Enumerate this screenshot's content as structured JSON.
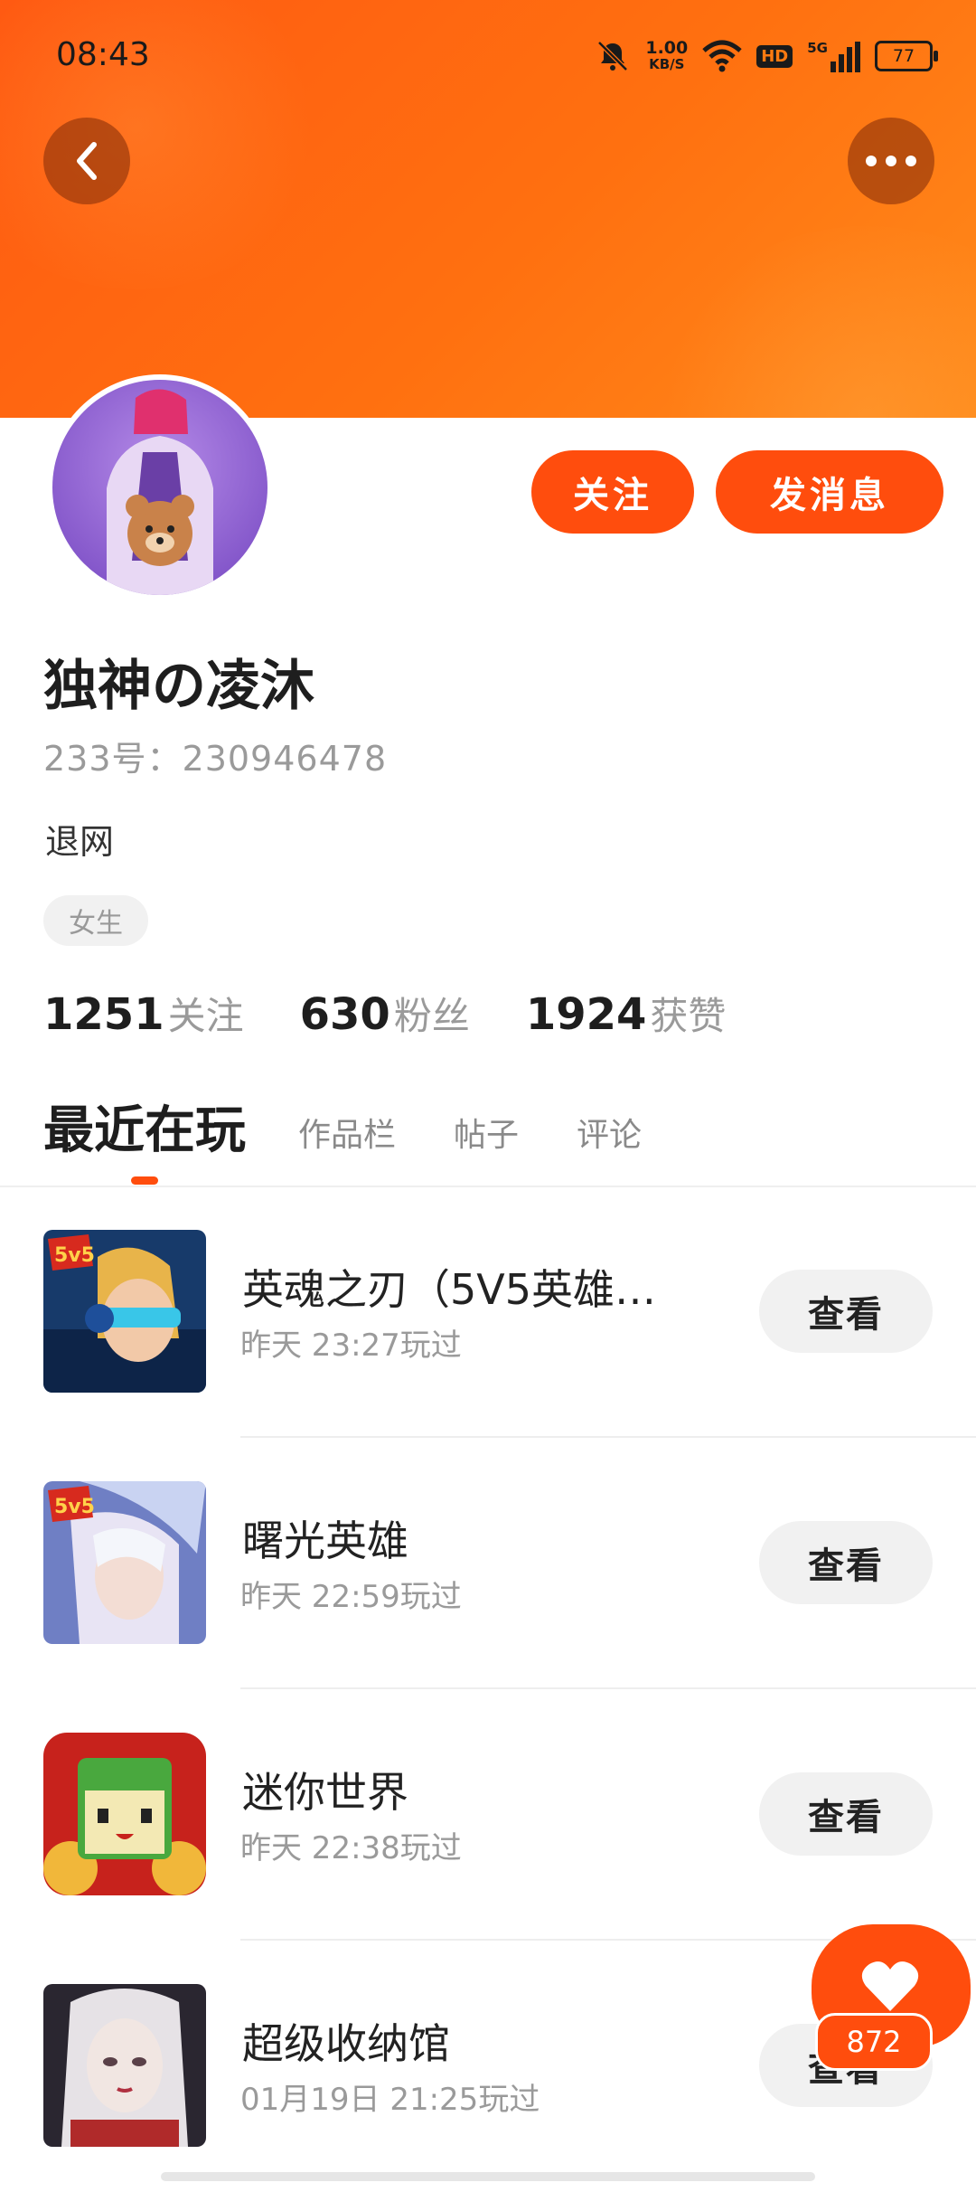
{
  "status_bar": {
    "time": "08:43",
    "speed_value": "1.00",
    "speed_unit": "KB/S",
    "hd": "HD",
    "network": "5G",
    "battery": "77"
  },
  "header": {
    "back_icon": "chevron-left-icon",
    "more_icon": "more-horizontal-icon"
  },
  "profile": {
    "follow_label": "关注",
    "message_label": "发消息",
    "name": "独神の凌沐",
    "uid": "233号：230946478",
    "bio": "退网",
    "gender_tag": "女生",
    "stats": [
      {
        "num": "1251",
        "label": "关注"
      },
      {
        "num": "630",
        "label": "粉丝"
      },
      {
        "num": "1924",
        "label": "获赞"
      }
    ]
  },
  "tabs": [
    {
      "label": "最近在玩",
      "active": true
    },
    {
      "label": "作品栏",
      "active": false
    },
    {
      "label": "帖子",
      "active": false
    },
    {
      "label": "评论",
      "active": false
    }
  ],
  "games": [
    {
      "title": "英魂之刃（5V5英雄…",
      "time": "昨天 23:27玩过",
      "action": "查看"
    },
    {
      "title": "曙光英雄",
      "time": "昨天 22:59玩过",
      "action": "查看"
    },
    {
      "title": "迷你世界",
      "time": "昨天 22:38玩过",
      "action": "查看"
    },
    {
      "title": "超级收纳馆",
      "time": "01月19日 21:25玩过",
      "action": "查看"
    }
  ],
  "like_fab": {
    "count": "872"
  },
  "colors": {
    "accent": "#ff4d0d",
    "banner": "#ff7010"
  }
}
